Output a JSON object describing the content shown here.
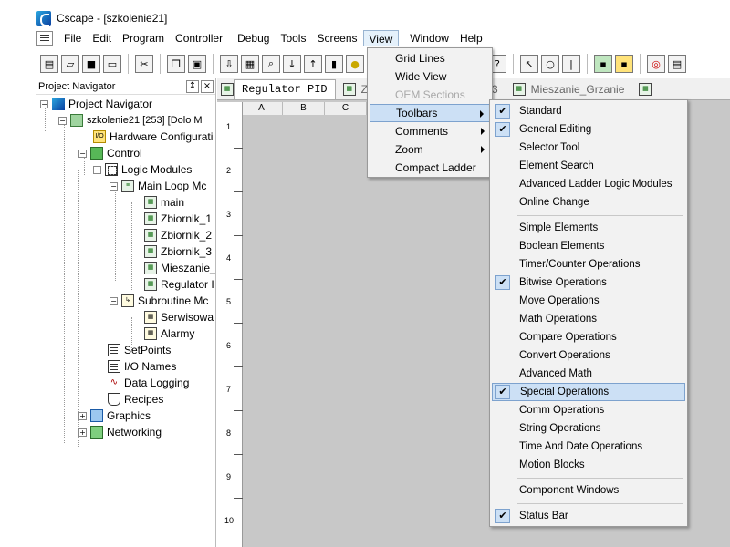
{
  "window": {
    "title": "Cscape - [szkolenie21]"
  },
  "menubar": {
    "items": [
      "File",
      "Edit",
      "Program",
      "Controller",
      "Debug",
      "Tools",
      "Screens",
      "View",
      "Window",
      "Help"
    ]
  },
  "navigator": {
    "title": "Project Navigator",
    "pin": "↕",
    "close": "×",
    "root": "Project Navigator",
    "project": "szkolenie21 [253] [Dolo M",
    "hardware": "Hardware Configurati",
    "control": "Control",
    "logic_modules": "Logic Modules",
    "main_loop": "Main Loop Mc",
    "programs": [
      "main",
      "Zbiornik_1",
      "Zbiornik_2",
      "Zbiornik_3",
      "Mieszanie_",
      "Regulator I"
    ],
    "subroutine": "Subroutine Mc",
    "subroutines": [
      "Serwisowa",
      "Alarmy"
    ],
    "setpoints": "SetPoints",
    "io_names": "I/O Names",
    "data_logging": "Data Logging",
    "recipes": "Recipes",
    "graphics": "Graphics",
    "networking": "Networking"
  },
  "editor": {
    "tabs": [
      "Regulator PID",
      "Z",
      "3",
      "Mieszanie_Grzanie"
    ],
    "columns": [
      "A",
      "B",
      "C"
    ],
    "rows": [
      "1",
      "2",
      "3",
      "4",
      "5",
      "6",
      "7",
      "8",
      "9",
      "10"
    ]
  },
  "view_menu": {
    "items": [
      {
        "label": "Grid Lines"
      },
      {
        "label": "Wide View"
      },
      {
        "label": "OEM Sections"
      },
      {
        "label": "Toolbars"
      },
      {
        "label": "Comments"
      },
      {
        "label": "Zoom"
      },
      {
        "label": "Compact Ladder"
      }
    ]
  },
  "toolbars_submenu": {
    "check": "✔",
    "items": [
      {
        "label": "Standard",
        "checked": true
      },
      {
        "label": "General Editing",
        "checked": true
      },
      {
        "label": "Selector Tool",
        "checked": false
      },
      {
        "label": "Element Search",
        "checked": false
      },
      {
        "label": "Advanced Ladder Logic Modules",
        "checked": false
      },
      {
        "label": "Online Change",
        "checked": false
      },
      {
        "label": "Simple Elements",
        "checked": false
      },
      {
        "label": "Boolean Elements",
        "checked": false
      },
      {
        "label": "Timer/Counter Operations",
        "checked": false
      },
      {
        "label": "Bitwise Operations",
        "checked": true
      },
      {
        "label": "Move Operations",
        "checked": false
      },
      {
        "label": "Math Operations",
        "checked": false
      },
      {
        "label": "Compare Operations",
        "checked": false
      },
      {
        "label": "Convert Operations",
        "checked": false
      },
      {
        "label": "Advanced Math",
        "checked": false
      },
      {
        "label": "Special Operations",
        "checked": true
      },
      {
        "label": "Comm Operations",
        "checked": false
      },
      {
        "label": "String Operations",
        "checked": false
      },
      {
        "label": "Time And Date Operations",
        "checked": false
      },
      {
        "label": "Motion Blocks",
        "checked": false
      },
      {
        "label": "Component Windows",
        "checked": false
      },
      {
        "label": "Status Bar",
        "checked": true
      }
    ]
  },
  "colors": {
    "highlight": "#cce0f5",
    "highlight_border": "#7da2ce",
    "editor_bg": "#c8c8c8"
  }
}
